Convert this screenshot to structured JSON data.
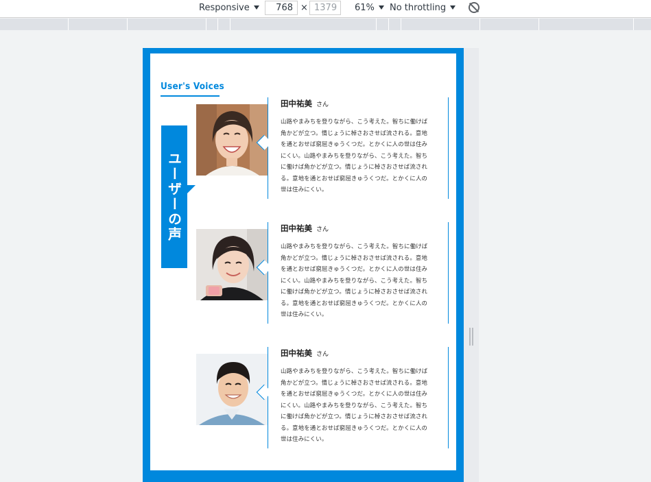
{
  "toolbar": {
    "device": "Responsive",
    "width": "768",
    "height": "1379",
    "zoom": "61%",
    "throttling": "No throttling",
    "times": "×"
  },
  "page": {
    "section_label": "User's Voices",
    "vertical_title": "ユーザーの声",
    "voices": [
      {
        "name": "田中祐美",
        "honorific": "さん",
        "text": "山路やまみちを登りながら、こう考えた。智ちに働けば角かどが立つ。情じょうに棹さおさせば流される。意地を通とおせば窮屈きゅうくつだ。とかくに人の世は住みにくい。山路やまみちを登りながら、こう考えた。智ちに働けば角かどが立つ。情じょうに棹さおさせば流される。意地を通とおせば窮屈きゅうくつだ。とかくに人の世は住みにくい。"
      },
      {
        "name": "田中祐美",
        "honorific": "さん",
        "text": "山路やまみちを登りながら、こう考えた。智ちに働けば角かどが立つ。情じょうに棹さおさせば流される。意地を通とおせば窮屈きゅうくつだ。とかくに人の世は住みにくい。山路やまみちを登りながら、こう考えた。智ちに働けば角かどが立つ。情じょうに棹さおさせば流される。意地を通とおせば窮屈きゅうくつだ。とかくに人の世は住みにくい。"
      },
      {
        "name": "田中祐美",
        "honorific": "さん",
        "text": "山路やまみちを登りながら、こう考えた。智ちに働けば角かどが立つ。情じょうに棹さおさせば流される。意地を通とおせば窮屈きゅうくつだ。とかくに人の世は住みにくい。山路やまみちを登りながら、こう考えた。智ちに働けば角かどが立つ。情じょうに棹さおさせば流される。意地を通とおせば窮屈きゅうくつだ。とかくに人の世は住みにくい。"
      }
    ]
  },
  "colors": {
    "accent": "#0088dd"
  }
}
